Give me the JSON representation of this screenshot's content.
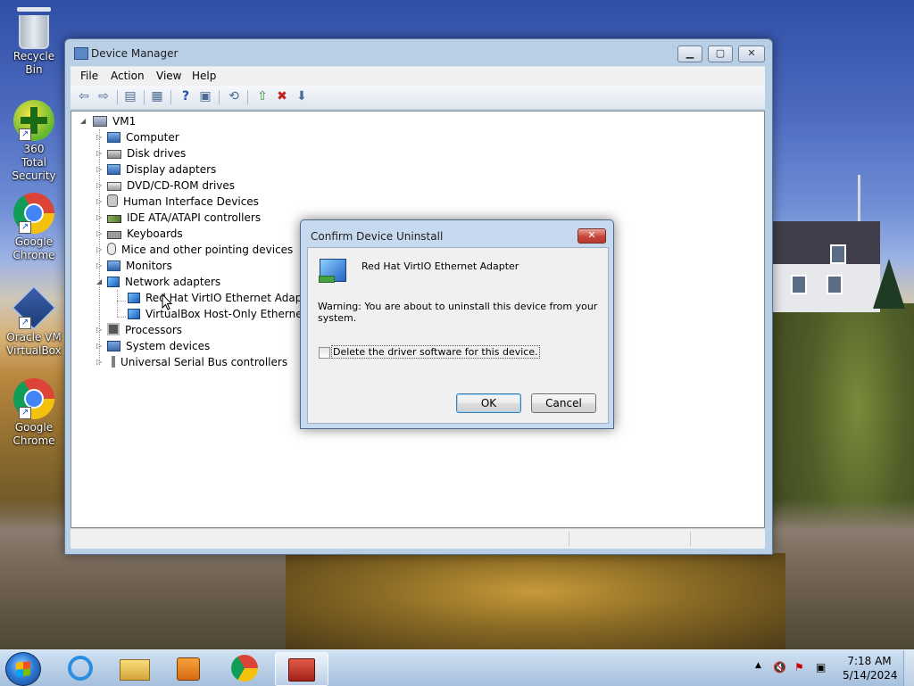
{
  "desktop": {
    "icons": [
      {
        "label": "Recycle Bin"
      },
      {
        "label": "360 Total Security"
      },
      {
        "label": "Google Chrome"
      },
      {
        "label": "Oracle VM VirtualBox"
      },
      {
        "label": "Google Chrome"
      }
    ]
  },
  "device_manager": {
    "title": "Device Manager",
    "menu": [
      "File",
      "Action",
      "View",
      "Help"
    ],
    "tree": {
      "root": "VM1",
      "categories": [
        "Computer",
        "Disk drives",
        "Display adapters",
        "DVD/CD-ROM drives",
        "Human Interface Devices",
        "IDE ATA/ATAPI controllers",
        "Keyboards",
        "Mice and other pointing devices",
        "Monitors",
        "Network adapters",
        "Processors",
        "System devices",
        "Universal Serial Bus controllers"
      ],
      "network_children": [
        "Red Hat VirtIO Ethernet Adapter",
        "VirtualBox Host-Only Ethernet Ad"
      ]
    }
  },
  "dialog": {
    "title": "Confirm Device Uninstall",
    "device_name": "Red Hat VirtIO Ethernet Adapter",
    "warning": "Warning: You are about to uninstall this device from your system.",
    "checkbox_label": "Delete the driver software for this device.",
    "checkbox_checked": false,
    "ok": "OK",
    "cancel": "Cancel"
  },
  "taskbar": {
    "time": "7:18 AM",
    "date": "5/14/2024",
    "tray_chevron": "▲"
  }
}
